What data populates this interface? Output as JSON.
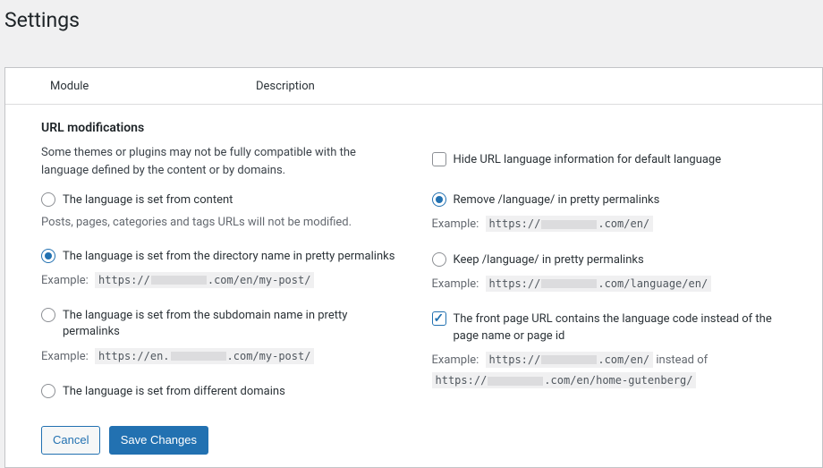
{
  "page": {
    "title": "Settings"
  },
  "table_headers": {
    "module": "Module",
    "description": "Description"
  },
  "section": {
    "title": "URL modifications",
    "intro": "Some themes or plugins may not be fully compatible with the language defined by the content or by domains."
  },
  "example_label": "Example:",
  "instead_of": "instead of",
  "left": {
    "opt_content": {
      "label": "The language is set from content",
      "note": "Posts, pages, categories and tags URLs will not be modified."
    },
    "opt_directory": {
      "label": "The language is set from the directory name in pretty permalinks",
      "example_pre": "https://",
      "example_post": ".com/en/my-post/"
    },
    "opt_subdomain": {
      "label": "The language is set from the subdomain name in pretty permalinks",
      "example_pre": "https://en.",
      "example_post": ".com/my-post/"
    },
    "opt_domains": {
      "label": "The language is set from different domains"
    }
  },
  "right": {
    "hide_default": {
      "label": "Hide URL language information for default language"
    },
    "remove_lang": {
      "label": "Remove /language/ in pretty permalinks",
      "example_pre": "https://",
      "example_post": ".com/en/"
    },
    "keep_lang": {
      "label": "Keep /language/ in pretty permalinks",
      "example_pre": "https://",
      "example_post": ".com/language/en/"
    },
    "front_page": {
      "label": "The front page URL contains the language code instead of the page name or page id",
      "example1_pre": "https://",
      "example1_post": ".com/en/",
      "example2_pre": "https://",
      "example2_post": ".com/en/home-gutenberg/"
    }
  },
  "buttons": {
    "cancel": "Cancel",
    "save": "Save Changes"
  }
}
